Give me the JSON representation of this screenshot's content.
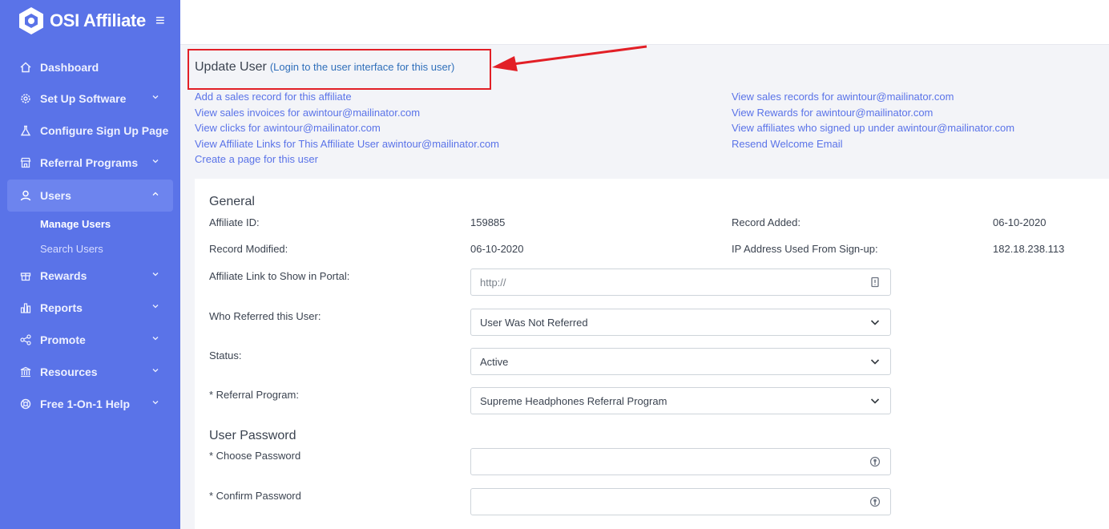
{
  "brand": {
    "name": "OSI Affiliate"
  },
  "sidebar": {
    "items": [
      {
        "label": "Dashboard",
        "icon": "home-icon"
      },
      {
        "label": "Set Up Software",
        "icon": "gear-icon"
      },
      {
        "label": "Configure Sign Up Page",
        "icon": "flask-icon"
      },
      {
        "label": "Referral Programs",
        "icon": "store-icon"
      },
      {
        "label": "Users",
        "icon": "user-icon"
      },
      {
        "label": "Rewards",
        "icon": "gift-icon"
      },
      {
        "label": "Reports",
        "icon": "bar-chart-icon"
      },
      {
        "label": "Promote",
        "icon": "share-icon"
      },
      {
        "label": "Resources",
        "icon": "bank-icon"
      },
      {
        "label": "Free 1-On-1 Help",
        "icon": "lifebuoy-icon"
      }
    ],
    "users_sub": [
      "Manage Users",
      "Search Users"
    ]
  },
  "header": {
    "title": "Update User",
    "login_link": "(Login to the user interface for this user)"
  },
  "links": {
    "left": [
      "Add a sales record for this affiliate",
      "View sales invoices for awintour@mailinator.com",
      "View clicks for awintour@mailinator.com",
      "View Affiliate Links for This Affiliate User awintour@mailinator.com",
      "Create a page for this user"
    ],
    "right": [
      "View sales records for awintour@mailinator.com",
      "View Rewards for awintour@mailinator.com",
      "View affiliates who signed up under awintour@mailinator.com",
      "Resend Welcome Email"
    ]
  },
  "general": {
    "title": "General",
    "affiliate_id_label": "Affiliate ID:",
    "affiliate_id": "159885",
    "record_added_label": "Record Added:",
    "record_added": "06-10-2020",
    "record_modified_label": "Record Modified:",
    "record_modified": "06-10-2020",
    "ip_label": "IP Address Used From Sign-up:",
    "ip": "182.18.238.113",
    "affiliate_link_label": "Affiliate Link to Show in Portal:",
    "affiliate_link_placeholder": "http://",
    "referred_label": "Who Referred this User:",
    "referred_value": "User Was Not Referred",
    "status_label": "Status:",
    "status_value": "Active",
    "program_label": "* Referral Program:",
    "program_value": "Supreme Headphones Referral Program"
  },
  "password": {
    "title": "User Password",
    "choose_label": "* Choose Password",
    "confirm_label": "* Confirm Password"
  },
  "colors": {
    "sidebar": "#5a73e8",
    "highlight": "#e21f26",
    "link": "#5a73e8"
  }
}
